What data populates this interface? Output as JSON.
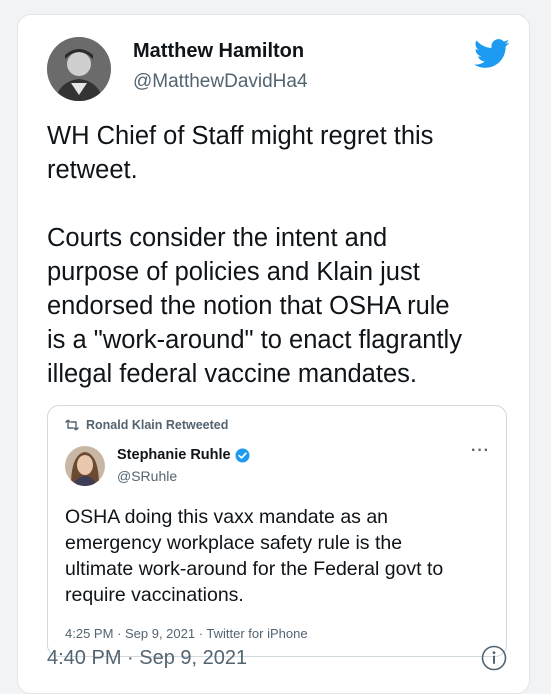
{
  "tweet": {
    "author_name": "Matthew Hamilton",
    "author_handle": "@MatthewDavidHa4",
    "text_paragraphs": [
      "WH Chief of Staff might regret this\nretweet.",
      "Courts consider the intent and\npurpose of policies and Klain just\nendorsed the notion that OSHA rule\nis a \"work-around\" to enact flagrantly\nillegal federal vaccine mandates."
    ],
    "timestamp": "4:40 PM · Sep 9, 2021",
    "brand_color": "#1d9bf0",
    "icons": {
      "logo": "twitter-bird-icon",
      "info": "info-icon"
    }
  },
  "quoted": {
    "retweeted_by": "Ronald Klain Retweeted",
    "author_name": "Stephanie Ruhle",
    "author_handle": "@SRuhle",
    "verified": true,
    "more_label": "···",
    "text": "OSHA doing this vaxx mandate as an\nemergency workplace safety rule is the\nultimate work-around for the Federal govt to\nrequire vaccinations.",
    "meta": "4:25 PM · Sep 9, 2021 · Twitter for iPhone",
    "icons": {
      "retweet": "retweet-icon",
      "verified": "verified-badge-icon",
      "more": "more-options-icon"
    }
  }
}
